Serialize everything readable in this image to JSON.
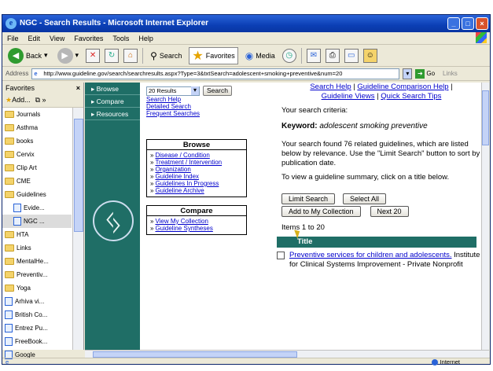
{
  "window": {
    "title": "NGC - Search Results - Microsoft Internet Explorer",
    "controls": [
      "_",
      "□",
      "×"
    ]
  },
  "menu": [
    "File",
    "Edit",
    "View",
    "Favorites",
    "Tools",
    "Help"
  ],
  "toolbar": {
    "back": "Back",
    "search": "Search",
    "favorites": "Favorites",
    "media": "Media"
  },
  "address": {
    "label": "Address",
    "url": "http://www.guideline.gov/search/searchresults.aspx?Type=3&txtSearch=adolescent+smoking+preventive&num=20",
    "go": "Go",
    "links": "Links"
  },
  "favorites_pane": {
    "title": "Favorites",
    "add": "Add...",
    "items": [
      {
        "label": "Journals",
        "type": "folder"
      },
      {
        "label": "Asthma",
        "type": "folder"
      },
      {
        "label": "books",
        "type": "folder"
      },
      {
        "label": "Cervix",
        "type": "folder"
      },
      {
        "label": "Clip Art",
        "type": "folder"
      },
      {
        "label": "CME",
        "type": "folder"
      },
      {
        "label": "Guidelines",
        "type": "folder"
      },
      {
        "label": "Evide...",
        "type": "page",
        "sub": true
      },
      {
        "label": "NGC ...",
        "type": "page",
        "sub": true,
        "selected": true
      },
      {
        "label": "HTA",
        "type": "folder"
      },
      {
        "label": "Links",
        "type": "folder"
      },
      {
        "label": "MentalHe...",
        "type": "folder"
      },
      {
        "label": "Preventiv...",
        "type": "folder"
      },
      {
        "label": "Yoga",
        "type": "folder"
      },
      {
        "label": "Arhiva vi...",
        "type": "page"
      },
      {
        "label": "British Co...",
        "type": "page"
      },
      {
        "label": "Entrez Pu...",
        "type": "page"
      },
      {
        "label": "FreeBook...",
        "type": "page"
      },
      {
        "label": "Google",
        "type": "page"
      }
    ]
  },
  "leftnav": [
    "Browse",
    "Compare",
    "Resources"
  ],
  "search_box": {
    "results_select": "20 Results",
    "search_button": "Search",
    "links": [
      "Search Help",
      "Detailed Search",
      "Frequent Searches"
    ]
  },
  "browse": {
    "title": "Browse",
    "links": [
      "Disease / Condition",
      "Treatment / Intervention",
      "Organization",
      "Guideline Index",
      "Guidelines In Progress",
      "Guideline Archive"
    ]
  },
  "compare": {
    "title": "Compare",
    "links": [
      "View My Collection",
      "Guideline Syntheses"
    ]
  },
  "main": {
    "top_links": [
      "Search Help",
      "Guideline Comparison Help",
      "Guideline Views",
      "Quick Search Tips"
    ],
    "criteria_label": "Your search criteria:",
    "keyword_label": "Keyword:",
    "keyword_value": "adolescent smoking preventive",
    "found_text": "Your search found 76 related guidelines, which are listed below by relevance. Use the \"Limit Search\" button to sort by publication date.",
    "view_text": "To view a guideline summary, click on a title below.",
    "limit_button": "Limit Search",
    "select_all_button": "Select All",
    "add_collection_button": "Add to My Collection",
    "next_button": "Next 20",
    "items_text": "Items 1 to 20",
    "title_header": "Title",
    "result_link": "Preventive services for children and adolescents.",
    "result_rest": " Institute for Clinical Systems Improvement - Private Nonprofit"
  },
  "status": {
    "zone": "Internet"
  }
}
